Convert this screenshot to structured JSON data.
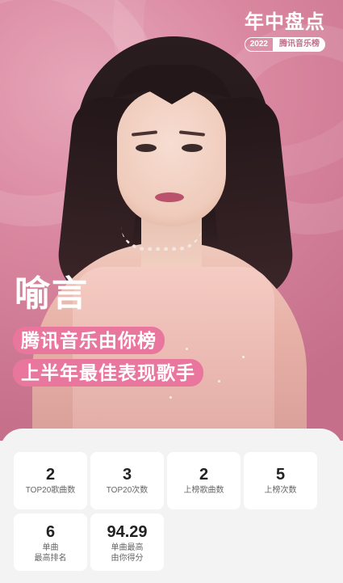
{
  "event": {
    "title": "年中盘点",
    "year": "2022",
    "brand": "腾讯音乐榜"
  },
  "artist": {
    "name": "喻言"
  },
  "award": {
    "line1": "腾讯音乐由你榜",
    "line2": "上半年最佳表现歌手"
  },
  "stats": [
    {
      "value": "2",
      "label": "TOP20歌曲数"
    },
    {
      "value": "3",
      "label": "TOP20次数"
    },
    {
      "value": "2",
      "label": "上榜歌曲数"
    },
    {
      "value": "5",
      "label": "上榜次数"
    },
    {
      "value": "6",
      "label": "单曲\n最高排名"
    },
    {
      "value": "94.29",
      "label": "单曲最高\n由你得分"
    }
  ],
  "colors": {
    "hero_pink": "#d9869f",
    "award_pill": "#e9769c",
    "panel_bg": "#f3f3f3"
  }
}
